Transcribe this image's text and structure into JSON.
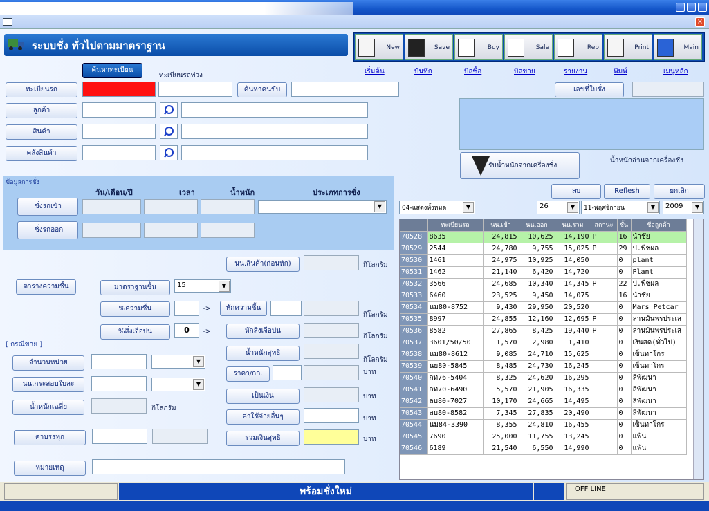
{
  "app": {
    "title": "ระบบชั่ง ทั่วไปตามมาตราฐาน",
    "status": "พร้อมชั่งใหม่",
    "mode": "OFF LINE"
  },
  "toolbar": [
    {
      "label": "New",
      "link": "เริ่มต้น"
    },
    {
      "label": "Save",
      "link": "บันทึก"
    },
    {
      "label": "Buy",
      "link": "บิลซื้อ"
    },
    {
      "label": "Sale",
      "link": "บิลขาย"
    },
    {
      "label": "Rep",
      "link": "รายงาน"
    },
    {
      "label": "Print",
      "link": "พิมพ์"
    },
    {
      "label": "Main",
      "link": "เมนูหลัก"
    }
  ],
  "search": {
    "find_plate": "ค้นหาทะเบียน",
    "trailer_plate": "ทะเบียนรถพ่วง",
    "find_driver": "ค้นหาคนขับ"
  },
  "fields": {
    "plate": "ทะเบียนรถ",
    "customer": "ลูกค้า",
    "product": "สินค้า",
    "warehouse": "คลังสินค้า"
  },
  "weigh": {
    "section": "ข้อมูลการชั่ง",
    "col_date": "วัน/เดือน/ปี",
    "col_time": "เวลา",
    "col_weight": "น้ำหนัก",
    "col_type": "ประเภทการชั่ง",
    "in_btn": "ชั่งรถเข้า",
    "out_btn": "ชั่งรถออก"
  },
  "right_panel": {
    "ticket_no": "เลขที่ใบชั่ง",
    "receive_btn": "รับน้ำหนักจากเครื่องชั่ง",
    "scale_label": "น้ำหนักอ่านจากเครื่องชั่ง",
    "delete": "ลบ",
    "refresh": "Reflesh",
    "cancel": "ยกเลิก",
    "filter": "04-แสดงทั้งหมด",
    "day": "26",
    "month": "11-พฤศจิกายน",
    "year": "2009"
  },
  "calc": {
    "cust_weight": "นน.สินค้า(ก่อนหัก)",
    "kg": "กิโลกรัม",
    "moisture_table": "ตารางความชื้น",
    "std_moisture": "มาตราฐานชื้น",
    "std_moisture_val": "15",
    "pct_moisture": "%ความชื้น",
    "deduct_moisture": "หักความชื้น",
    "pct_impurity": "%สิ่งเจือปน",
    "pct_impurity_val": "0",
    "deduct_impurity": "หักสิ่งเจือปน",
    "sale_case": "[ กรณีขาย ]",
    "unit_qty": "จำนวนหน่วย",
    "net_weight": "น้ำหนักสุทธิ",
    "bag_weight": "นน.กระสอบใบละ",
    "price_kg": "ราคา/กก.",
    "baht": "บาท",
    "avg_weight": "น้ำหนักเฉลี่ย",
    "amount": "เป็นเงิน",
    "other_exp": "ค่าใช้จ่ายอื่นๆ",
    "freight": "ค่าบรรทุก",
    "net_total": "รวมเงินสุทธิ",
    "remark": "หมายเหตุ",
    "arrow": "->"
  },
  "grid": {
    "headers": [
      "",
      "ทะเบียนรถ",
      "นน.เข้า",
      "นน.ออก",
      "นน.รวม",
      "สถานะ",
      "ชั้น",
      "ชื่อลูกค้า"
    ],
    "rows": [
      [
        "70528",
        "8635",
        "24,815",
        "10,625",
        "14,190",
        "P",
        "16",
        "นำชัย"
      ],
      [
        "70529",
        "2544",
        "24,780",
        "9,755",
        "15,025",
        "P",
        "29",
        "ป.พืชผล"
      ],
      [
        "70530",
        "1461",
        "24,975",
        "10,925",
        "14,050",
        "",
        "0",
        "plant"
      ],
      [
        "70531",
        "1462",
        "21,140",
        "6,420",
        "14,720",
        "",
        "0",
        "Plant"
      ],
      [
        "70532",
        "3566",
        "24,685",
        "10,340",
        "14,345",
        "P",
        "22",
        "ป.พืชผล"
      ],
      [
        "70533",
        "6460",
        "23,525",
        "9,450",
        "14,075",
        "",
        "16",
        "นำชัย"
      ],
      [
        "70534",
        "นม80-8752",
        "9,430",
        "29,950",
        "20,520",
        "",
        "0",
        "Mars Petcar"
      ],
      [
        "70535",
        "8997",
        "24,855",
        "12,160",
        "12,695",
        "P",
        "0",
        "ลานมันพรประเส"
      ],
      [
        "70536",
        "8582",
        "27,865",
        "8,425",
        "19,440",
        "P",
        "0",
        "ลานมันพรประเส"
      ],
      [
        "70537",
        "3601/50/50",
        "1,570",
        "2,980",
        "1,410",
        "",
        "0",
        "เงินสด(ทั่วไป)"
      ],
      [
        "70538",
        "นม80-8612",
        "9,085",
        "24,710",
        "15,625",
        "",
        "0",
        "เซ็นทาโกร"
      ],
      [
        "70539",
        "นย80-5845",
        "8,485",
        "24,730",
        "16,245",
        "",
        "0",
        "เซ็นทาโกร"
      ],
      [
        "70540",
        "กท76-5404",
        "8,325",
        "24,620",
        "16,295",
        "",
        "0",
        "ลิพัฒนา"
      ],
      [
        "70541",
        "กท70-6490",
        "5,570",
        "21,905",
        "16,335",
        "",
        "0",
        "ลิพัฒนา"
      ],
      [
        "70542",
        "ลบ80-7027",
        "10,170",
        "24,665",
        "14,495",
        "",
        "0",
        "ลิพัฒนา"
      ],
      [
        "70543",
        "ลบ80-8582",
        "7,345",
        "27,835",
        "20,490",
        "",
        "0",
        "ลิพัฒนา"
      ],
      [
        "70544",
        "นม84-3390",
        "8,355",
        "24,810",
        "16,455",
        "",
        "0",
        "เซ็นทาโกร"
      ],
      [
        "70545",
        "7690",
        "25,000",
        "11,755",
        "13,245",
        "",
        "0",
        "แพ้น"
      ],
      [
        "70546",
        "6189",
        "21,540",
        "6,550",
        "14,990",
        "",
        "0",
        "แพ้น"
      ]
    ]
  }
}
